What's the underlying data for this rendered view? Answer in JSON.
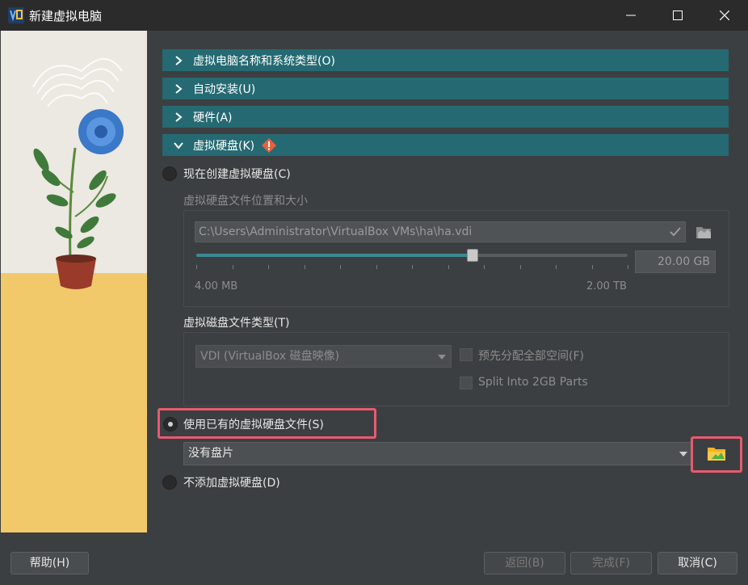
{
  "window": {
    "title": "新建虚拟电脑"
  },
  "sections": [
    {
      "label": "虚拟电脑名称和系统类型(O)",
      "expanded": false
    },
    {
      "label": "自动安装(U)",
      "expanded": false
    },
    {
      "label": "硬件(A)",
      "expanded": false
    },
    {
      "label": "虚拟硬盘(K)",
      "expanded": true,
      "warning": true
    }
  ],
  "disk": {
    "option_create": "现在创建虚拟硬盘(C)",
    "location_size_label": "虚拟硬盘文件位置和大小",
    "path_value": "C:\\Users\\Administrator\\VirtualBox VMs\\ha\\ha.vdi",
    "size_value": "20.00 GB",
    "size_fraction": 0.64,
    "scale_min": "4.00 MB",
    "scale_max": "2.00 TB",
    "file_type_label": "虚拟磁盘文件类型(T)",
    "file_type_value": "VDI (VirtualBox 磁盘映像)",
    "preallocate_label": "预先分配全部空间(F)",
    "split_label": "Split Into 2GB Parts",
    "option_existing": "使用已有的虚拟硬盘文件(S)",
    "existing_value": "没有盘片",
    "option_none": "不添加虚拟硬盘(D)",
    "selected_option": "existing"
  },
  "buttons": {
    "help": "帮助(H)",
    "back": "返回(B)",
    "finish": "完成(F)",
    "cancel": "取消(C)"
  },
  "colors": {
    "section_header": "#256a72",
    "highlight": "#e85a6e",
    "background": "#3c3f41"
  },
  "icons": [
    "virtualbox-app-icon",
    "minimize-icon",
    "maximize-icon",
    "close-icon",
    "chevron-right-icon",
    "chevron-down-icon",
    "warning-icon",
    "checkmark-icon",
    "folder-icon",
    "folder-add-icon"
  ]
}
